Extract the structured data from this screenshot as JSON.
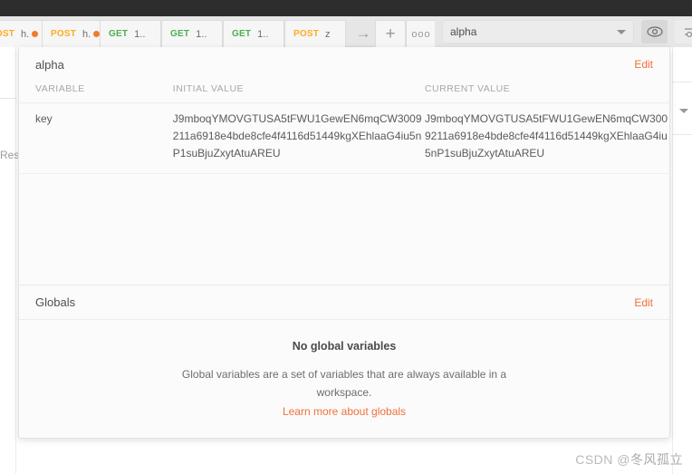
{
  "window": {
    "watermark_prefix": "CSDN @",
    "watermark_name": "冬风孤立"
  },
  "tabs": [
    {
      "method": "POST",
      "name": "h.",
      "unsaved": true,
      "truncated_left": true
    },
    {
      "method": "POST",
      "name": "h.",
      "unsaved": true
    },
    {
      "method": "GET",
      "name": "1..",
      "unsaved": false
    },
    {
      "method": "GET",
      "name": "1..",
      "unsaved": false
    },
    {
      "method": "GET",
      "name": "1..",
      "unsaved": false
    },
    {
      "method": "POST",
      "name": "z",
      "unsaved": false
    }
  ],
  "tab_controls": {
    "next_arrow": "→",
    "add_label": "+",
    "more_label": "ooo"
  },
  "environment_bar": {
    "selected": "alpha",
    "eye_icon": "eye-icon",
    "settings_icon": "sliders-icon",
    "caret_icon": "chevron-down-icon"
  },
  "left_rail": {
    "response_label": "Res"
  },
  "popup": {
    "environment": {
      "title": "alpha",
      "edit_label": "Edit",
      "columns": [
        "VARIABLE",
        "INITIAL VALUE",
        "CURRENT VALUE"
      ],
      "rows": [
        {
          "variable": "key",
          "initial_value": "J9mboqYMOVGTUSA5tFWU1GewEN6mqCW3009211a6918e4bde8cfe4f4116d51449kgXEhlaaG4iu5nP1suBjuZxytAtuAREU",
          "current_value": "J9mboqYMOVGTUSA5tFWU1GewEN6mqCW3009211a6918e4bde8cfe4f4116d51449kgXEhlaaG4iu5nP1suBjuZxytAtuAREU"
        }
      ]
    },
    "globals": {
      "title": "Globals",
      "edit_label": "Edit",
      "empty_title": "No global variables",
      "empty_description": "Global variables are a set of variables that are always available in a workspace.",
      "learn_more_label": "Learn more about globals"
    }
  },
  "colors": {
    "accent": "#f0703a",
    "get_method": "#4caf50",
    "post_method": "#ffab22",
    "unsaved_dot": "#ef7c2a"
  }
}
